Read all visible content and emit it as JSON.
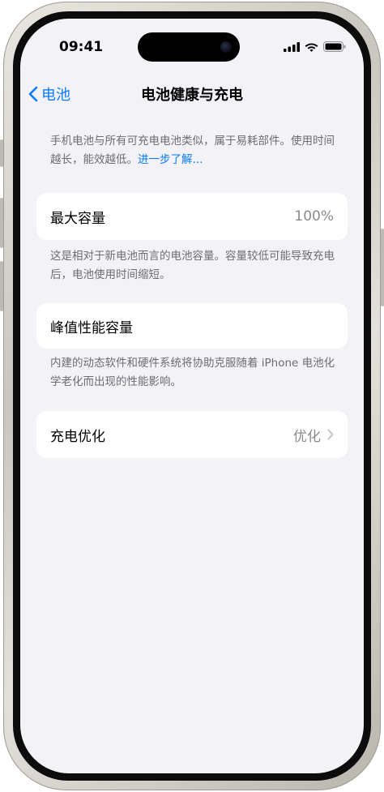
{
  "status_bar": {
    "time": "09:41",
    "icons": [
      "signal-icon",
      "wifi-icon",
      "battery-icon"
    ]
  },
  "nav": {
    "back_label": "电池",
    "title": "电池健康与充电"
  },
  "intro": {
    "text": "手机电池与所有可充电电池类似，属于易耗部件。使用时间越长，能效越低。",
    "link": "进一步了解..."
  },
  "max_capacity": {
    "label": "最大容量",
    "value": "100%",
    "footer": "这是相对于新电池而言的电池容量。容量较低可能导致充电后，电池使用时间缩短。"
  },
  "peak_performance": {
    "label": "峰值性能容量",
    "footer": "内建的动态软件和硬件系统将协助克服随着 iPhone 电池化学老化而出现的性能影响。"
  },
  "charging_optimization": {
    "label": "充电优化",
    "value": "优化"
  },
  "colors": {
    "accent": "#0a7aff",
    "background": "#f2f2f7",
    "secondary_text": "#6c6c72"
  }
}
